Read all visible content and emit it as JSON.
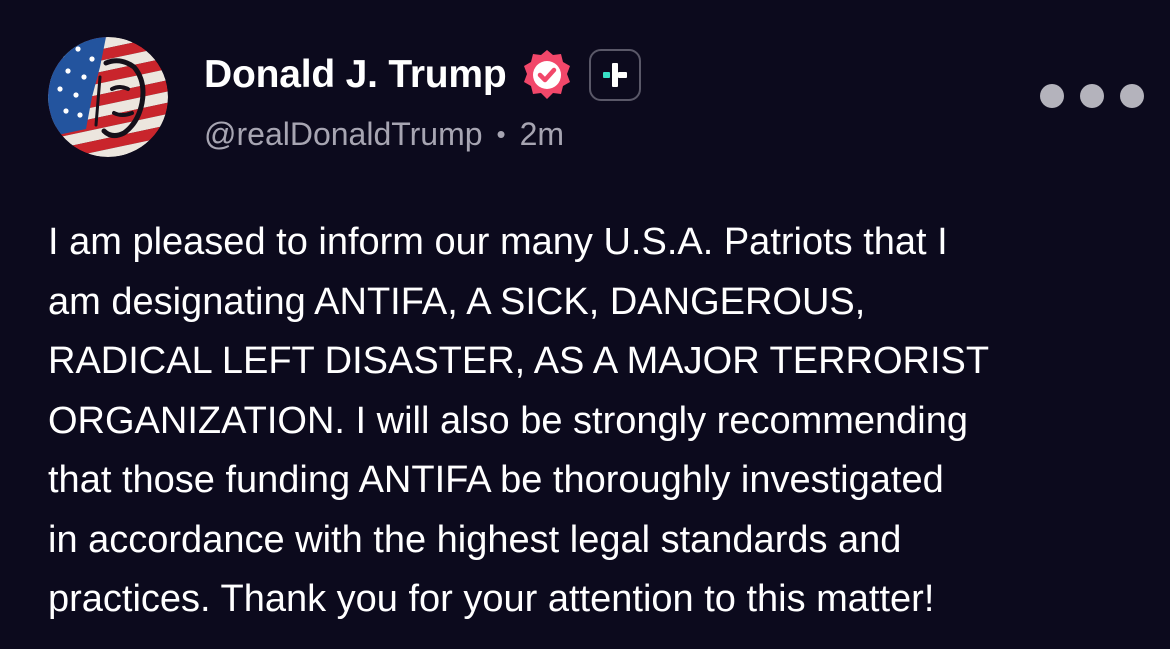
{
  "post": {
    "author": {
      "display_name": "Donald J. Trump",
      "handle": "@realDonaldTrump",
      "avatar_icon": "patriotic-portrait-avatar",
      "verified_icon": "verified-badge-icon",
      "verified_color": "#f2476a",
      "plus_badge_icon": "plus-badge-icon",
      "plus_accent_color": "#38e0c6"
    },
    "separator": "•",
    "timestamp": "2m",
    "more_icon": "more-options-icon",
    "text_lines": [
      "I am pleased to inform our many U.S.A. Patriots that I",
      "am designating ANTIFA, A SICK, DANGEROUS,",
      "RADICAL LEFT DISASTER, AS A MAJOR TERRORIST",
      "ORGANIZATION. I will also be strongly recommending",
      "that those funding ANTIFA be thoroughly investigated",
      "in accordance with the highest legal standards and",
      "practices. Thank you for your attention to this matter!"
    ]
  },
  "colors": {
    "background": "#0c0a1d",
    "primary_text": "#ffffff",
    "secondary_text": "#a7a5b2"
  }
}
